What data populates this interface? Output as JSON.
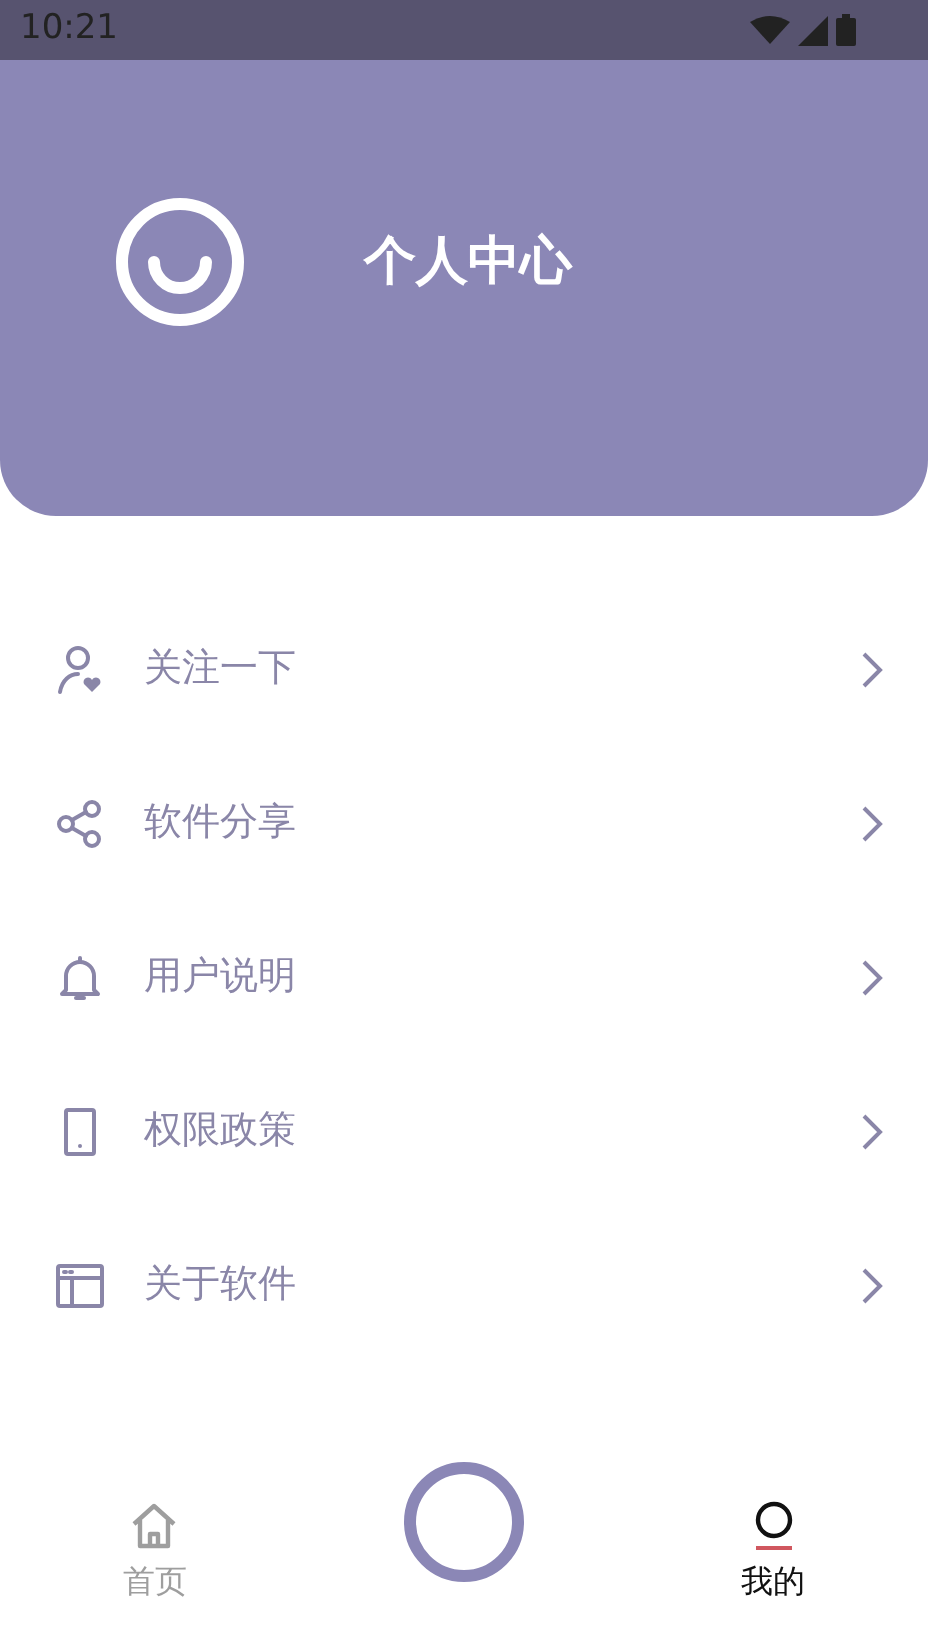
{
  "status_bar": {
    "time": "10:21"
  },
  "header": {
    "title": "个人中心"
  },
  "menu": [
    {
      "kind": "follow",
      "label": "关注一下"
    },
    {
      "kind": "share",
      "label": "软件分享"
    },
    {
      "kind": "bell",
      "label": "用户说明"
    },
    {
      "kind": "phone",
      "label": "权限政策"
    },
    {
      "kind": "window",
      "label": "关于软件"
    }
  ],
  "bottom_nav": [
    {
      "kind": "home",
      "label": "首页",
      "selected": false
    },
    {
      "kind": "center"
    },
    {
      "kind": "me",
      "label": "我的",
      "selected": true
    }
  ]
}
